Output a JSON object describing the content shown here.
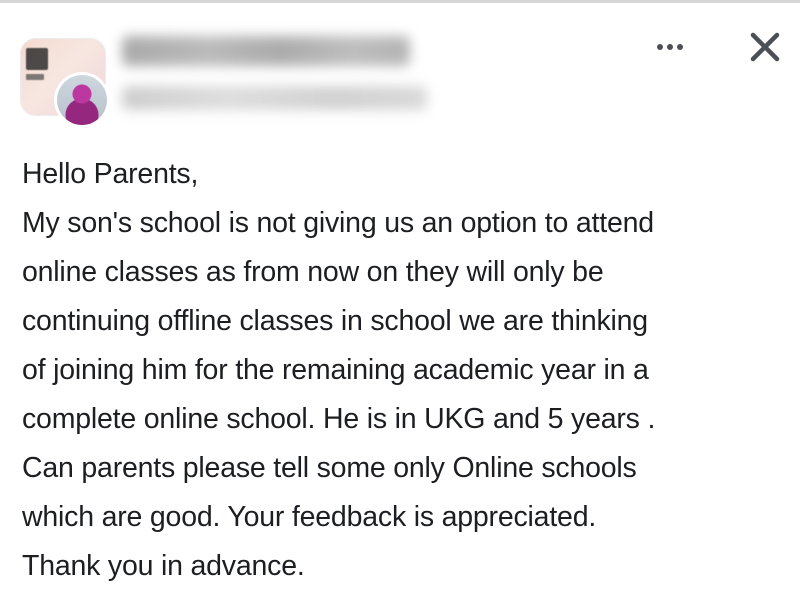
{
  "post": {
    "header": {
      "group_name": "Bangalore Schools",
      "more_icon": "more-options-icon",
      "close_icon": "close-icon"
    },
    "body_lines": [
      "Hello Parents,",
      "My son's school is not giving us an option to attend",
      "online classes as from now on they will only be",
      "continuing offline classes in school we are thinking",
      "of joining him for the remaining academic year in a",
      "complete online school. He is in UKG and 5 years .",
      "Can parents please tell some only Online schools",
      "which are good. Your feedback is appreciated.",
      "Thank you in advance."
    ]
  },
  "colors": {
    "text": "#1c1e21",
    "icon": "#4b4f56",
    "divider": "#d6d6d6"
  }
}
